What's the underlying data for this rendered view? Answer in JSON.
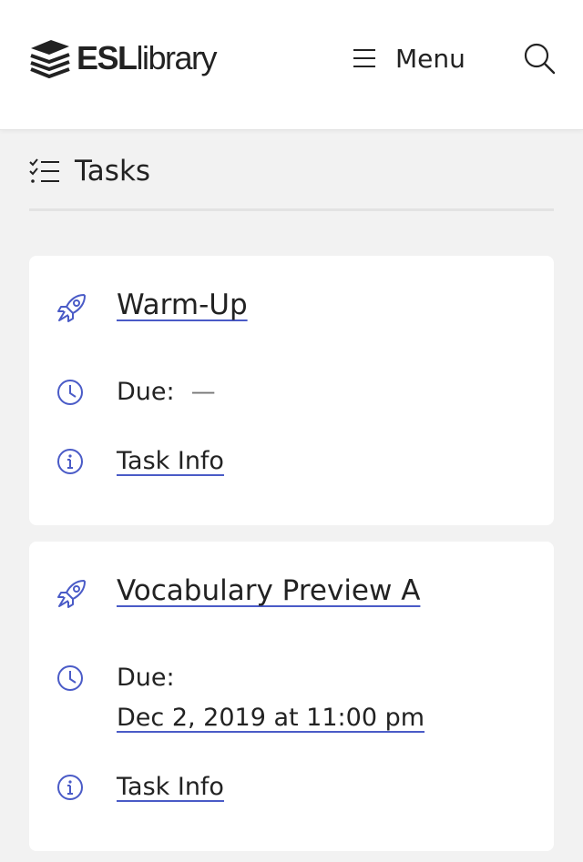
{
  "header": {
    "logo_bold": "ESL",
    "logo_light": "library",
    "menu_label": "Menu"
  },
  "tasks_section": {
    "title": "Tasks"
  },
  "tasks": [
    {
      "title": "Warm-Up",
      "due_label": "Due:",
      "due_value": "—",
      "info_label": "Task Info"
    },
    {
      "title": "Vocabulary Preview A",
      "due_label": "Due:",
      "due_value": "Dec 2, 2019 at 11:00 pm",
      "info_label": "Task Info"
    }
  ],
  "icons": {
    "logo": "stacked-books-icon",
    "menu": "hamburger-icon",
    "search": "search-icon",
    "tasks": "checklist-icon",
    "task_type": "rocket-icon",
    "due": "clock-icon",
    "info": "info-icon"
  },
  "colors": {
    "accent": "#4a5bc7",
    "background": "#f2f2f2",
    "card": "#ffffff",
    "text": "#222222"
  }
}
